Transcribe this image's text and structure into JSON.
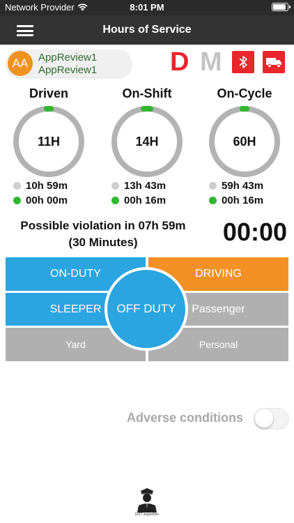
{
  "status_bar": {
    "carrier": "Network Provider",
    "time": "8:01 PM"
  },
  "header": {
    "title": "Hours of Service"
  },
  "user": {
    "initials": "AA",
    "name_line1": "AppReview1",
    "name_line2": "AppReview1"
  },
  "indicators": {
    "d_label": "D",
    "m_label": "M",
    "bluetooth_icon": "bluetooth-icon",
    "truck_icon": "truck-icon"
  },
  "gauges": [
    {
      "title": "Driven",
      "value": "11H",
      "remaining": "10h 59m",
      "used": "00h 00m"
    },
    {
      "title": "On-Shift",
      "value": "14H",
      "remaining": "13h 43m",
      "used": "00h 16m"
    },
    {
      "title": "On-Cycle",
      "value": "60H",
      "remaining": "59h 43m",
      "used": "00h 16m"
    }
  ],
  "violation": {
    "line1": "Possible violation in 07h 59m",
    "line2": "(30 Minutes)",
    "timer": "00:00"
  },
  "duty_status": {
    "on_duty": "ON-DUTY",
    "driving": "DRIVING",
    "sleeper": "SLEEPER",
    "off_duty": "OFF DUTY",
    "passenger": "Passenger",
    "yard": "Yard",
    "personal": "Personal"
  },
  "adverse": {
    "label": "Adverse conditions",
    "enabled": false
  },
  "footer": {
    "dot_label": "DOT inspection"
  },
  "colors": {
    "on_duty": "#2aa5e0",
    "driving": "#f39125",
    "inactive": "#b0b0b0",
    "alert_red": "#e8262b",
    "avatar": "#f0921e",
    "progress_green": "#2eb82e"
  }
}
